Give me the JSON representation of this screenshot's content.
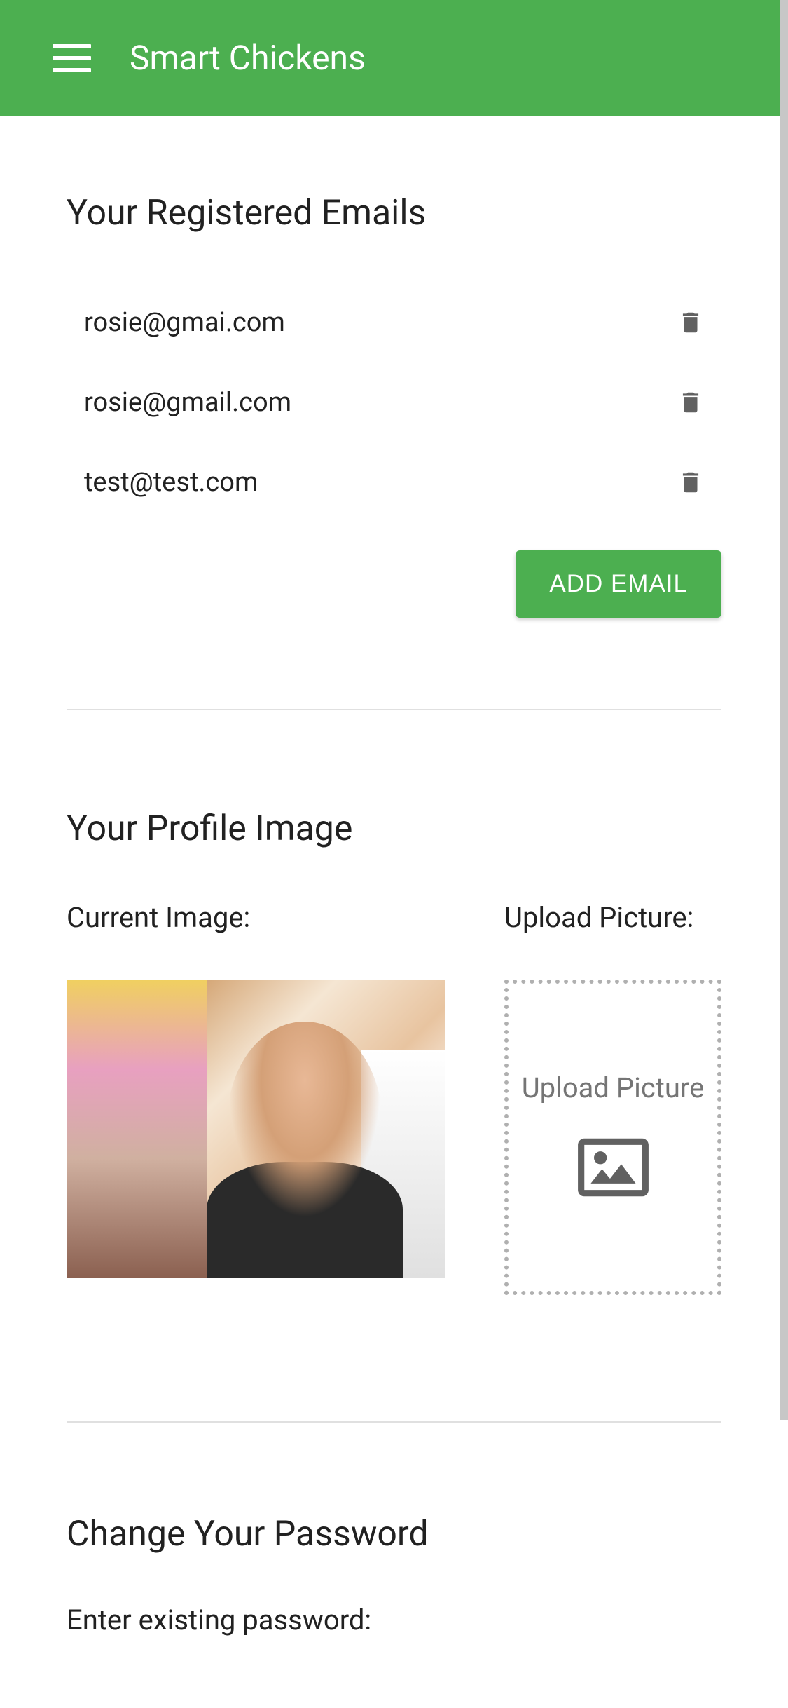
{
  "header": {
    "app_title": "Smart Chickens"
  },
  "emails_section": {
    "title": "Your Registered Emails",
    "items": [
      {
        "address": "rosie@gmai.com"
      },
      {
        "address": "rosie@gmail.com"
      },
      {
        "address": "test@test.com"
      }
    ],
    "add_button_label": "ADD EMAIL"
  },
  "profile_section": {
    "title": "Your Profile Image",
    "current_label": "Current Image:",
    "upload_label": "Upload Picture:",
    "upload_box_text": "Upload Picture"
  },
  "password_section": {
    "title": "Change Your Password",
    "existing_label": "Enter existing password:"
  },
  "colors": {
    "primary": "#4CAF50",
    "icon_gray": "#616161"
  }
}
